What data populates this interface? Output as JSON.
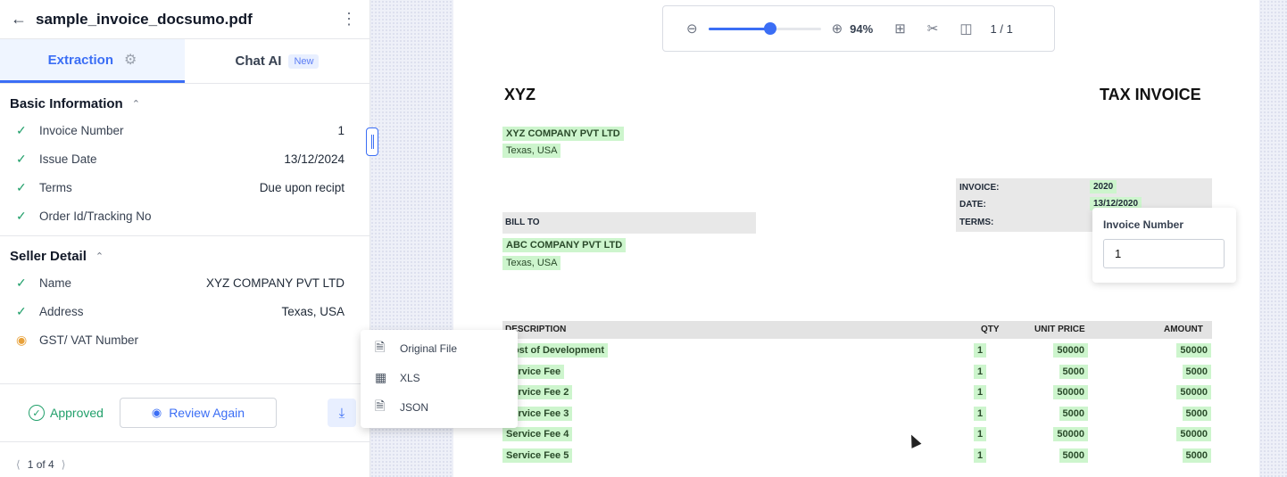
{
  "header": {
    "back_icon": "arrow-left-icon",
    "file_name": "sample_invoice_docsumo.pdf",
    "menu_icon": "kebab-icon"
  },
  "tabs": [
    {
      "label": "Extraction",
      "active": true
    },
    {
      "label": "Chat AI",
      "badge": "New",
      "active": false
    }
  ],
  "sections": [
    {
      "title": "Basic Information",
      "fields": [
        {
          "label": "Invoice Number",
          "value": "1",
          "status": "check"
        },
        {
          "label": "Issue Date",
          "value": "13/12/2024",
          "status": "check"
        },
        {
          "label": "Terms",
          "value": "Due upon recipt",
          "status": "check"
        },
        {
          "label": "Order Id/Tracking No",
          "value": "",
          "status": "check"
        }
      ]
    },
    {
      "title": "Seller Detail",
      "fields": [
        {
          "label": "Name",
          "value": "XYZ COMPANY PVT LTD",
          "status": "check"
        },
        {
          "label": "Address",
          "value": "Texas, USA",
          "status": "check"
        },
        {
          "label": "GST/ VAT Number",
          "value": "",
          "status": "review"
        }
      ]
    }
  ],
  "footer": {
    "approved": "Approved",
    "review_again": "Review Again"
  },
  "pager": {
    "text": "1 of 4"
  },
  "toolbar": {
    "zoom": "94%",
    "page": "1 / 1",
    "zoom_fraction": 0.55
  },
  "download_menu": [
    "Original File",
    "XLS",
    "JSON"
  ],
  "invoice": {
    "company_short": "XYZ",
    "doc_title": "TAX INVOICE",
    "seller_name": "XYZ COMPANY PVT LTD",
    "seller_address": "Texas, USA",
    "meta_labels": [
      "INVOICE:",
      "DATE:",
      "TERMS:"
    ],
    "meta_values": [
      "2020",
      "13/12/2020"
    ],
    "bill_to": "BILL TO",
    "buyer_name": "ABC COMPANY PVT LTD",
    "buyer_address": "Texas, USA",
    "table_headers": [
      "DESCRIPTION",
      "QTY",
      "UNIT PRICE",
      "AMOUNT"
    ],
    "rows": [
      {
        "desc": "Cost of Development",
        "qty": "1",
        "price": "50000",
        "amount": "50000"
      },
      {
        "desc": "Service Fee",
        "qty": "1",
        "price": "5000",
        "amount": "5000"
      },
      {
        "desc": "Service Fee 2",
        "qty": "1",
        "price": "50000",
        "amount": "50000"
      },
      {
        "desc": "Service Fee 3",
        "qty": "1",
        "price": "5000",
        "amount": "5000"
      },
      {
        "desc": "Service Fee 4",
        "qty": "1",
        "price": "50000",
        "amount": "50000"
      },
      {
        "desc": "Service Fee 5",
        "qty": "1",
        "price": "5000",
        "amount": "5000"
      }
    ]
  },
  "field_popup": {
    "label": "Invoice Number",
    "value": "1"
  }
}
